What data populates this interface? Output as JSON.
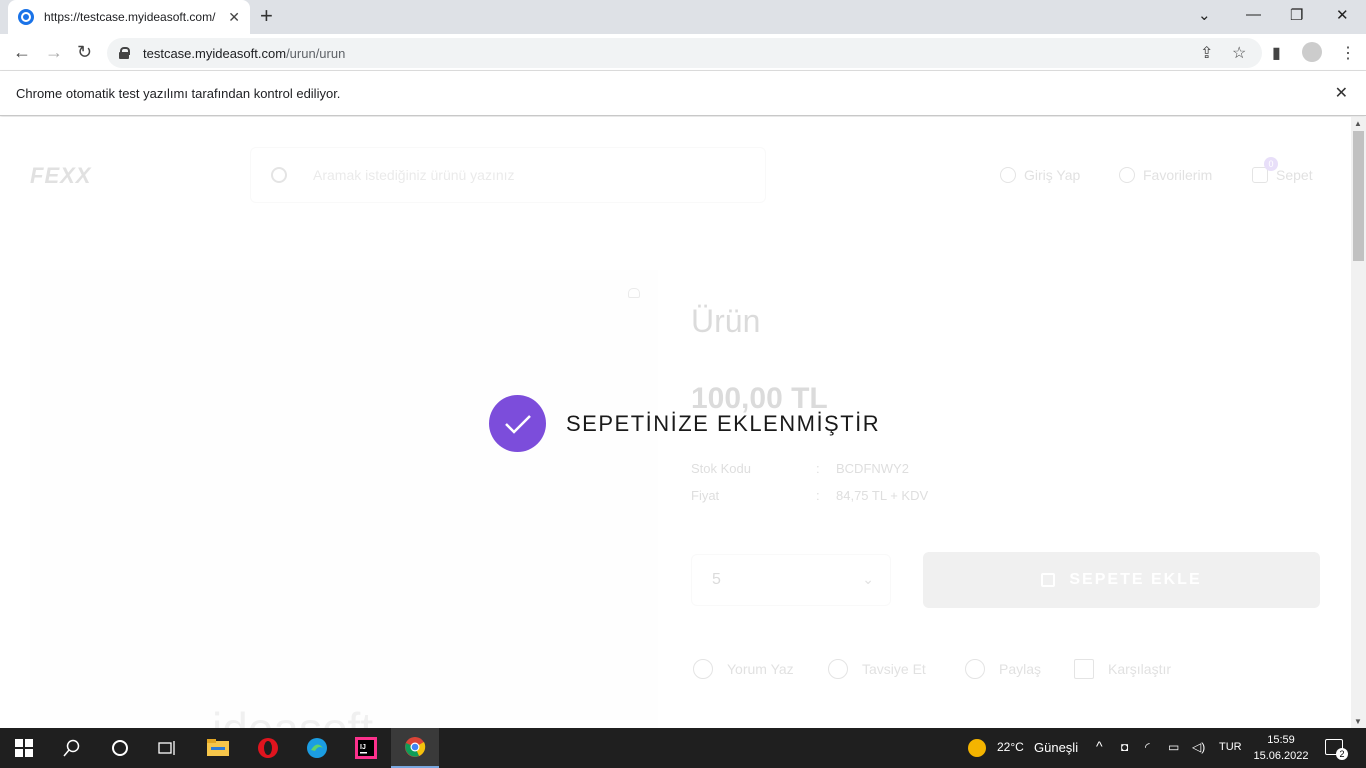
{
  "browser": {
    "tab_title": "https://testcase.myideasoft.com/",
    "url_host": "testcase.myideasoft.com",
    "url_path": "/urun/urun",
    "infobar_text": "Chrome otomatik test yazılımı tarafından kontrol ediliyor."
  },
  "site": {
    "logo": "FEXX",
    "search_placeholder": "Aramak istediğiniz ürünü yazınız",
    "login_label": "Giriş Yap",
    "favorites_label": "Favorilerim",
    "cart_label": "Sepet",
    "cart_count": "0"
  },
  "product": {
    "name": "Ürün",
    "price": "100,00 TL",
    "stock_code_label": "Stok Kodu",
    "stock_code_value": "BCDFNWY2",
    "price_label": "Fiyat",
    "price_value": "84,75 TL + KDV",
    "separator": ":",
    "quantity": "5",
    "add_to_cart": "SEPETE EKLE",
    "actions": [
      "Yorum Yaz",
      "Tavsiye Et",
      "Paylaş",
      "Karşılaştır"
    ],
    "watermark": "ideasoft"
  },
  "toast": {
    "message": "SEPETİNİZE EKLENMİŞTİR",
    "color": "#7c4ddb"
  },
  "taskbar": {
    "weather_temp": "22°C",
    "weather_text": "Güneşli",
    "language": "TUR",
    "time": "15:59",
    "date": "15.06.2022",
    "notification_count": "2"
  }
}
